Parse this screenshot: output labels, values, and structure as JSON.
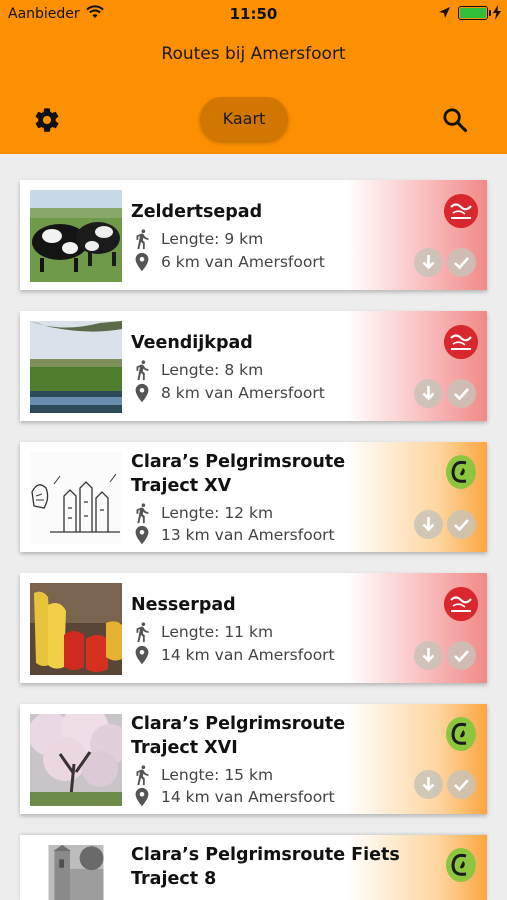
{
  "statusbar": {
    "carrier": "Aanbieder",
    "time": "11:50"
  },
  "header": {
    "title": "Routes bij Amersfoort",
    "map_button": "Kaart"
  },
  "colors": {
    "header": "#fc9000",
    "map_button": "#d17600",
    "red_logo": "#d9272e",
    "green_logo": "#8cc63f"
  },
  "routes": [
    {
      "title": "Zeldertsepad",
      "length": "Lengte: 9 km",
      "distance": "6 km van Amersfoort",
      "logo": "wandelnetwerk-red-icon",
      "thumb": "cows-photo"
    },
    {
      "title": "Veendijkpad",
      "length": "Lengte: 8 km",
      "distance": "8 km van Amersfoort",
      "logo": "wandelnetwerk-red-icon",
      "thumb": "landscape-photo"
    },
    {
      "title": "Clara’s Pelgrimsroute Traject XV",
      "length": "Lengte: 12 km",
      "distance": "13 km van Amersfoort",
      "logo": "pelgrim-green-icon",
      "thumb": "sketch-drawing"
    },
    {
      "title": "Nesserpad",
      "length": "Lengte: 11 km",
      "distance": "14 km van Amersfoort",
      "logo": "wandelnetwerk-red-icon",
      "thumb": "clogs-photo"
    },
    {
      "title": "Clara’s Pelgrimsroute Traject XVI",
      "length": "Lengte: 15 km",
      "distance": "14 km van Amersfoort",
      "logo": "pelgrim-green-icon",
      "thumb": "blossom-photo"
    },
    {
      "title": "Clara’s Pelgrimsroute Fiets Traject 8",
      "length": "",
      "distance": "",
      "logo": "pelgrim-green-icon",
      "thumb": "church-photo"
    }
  ]
}
